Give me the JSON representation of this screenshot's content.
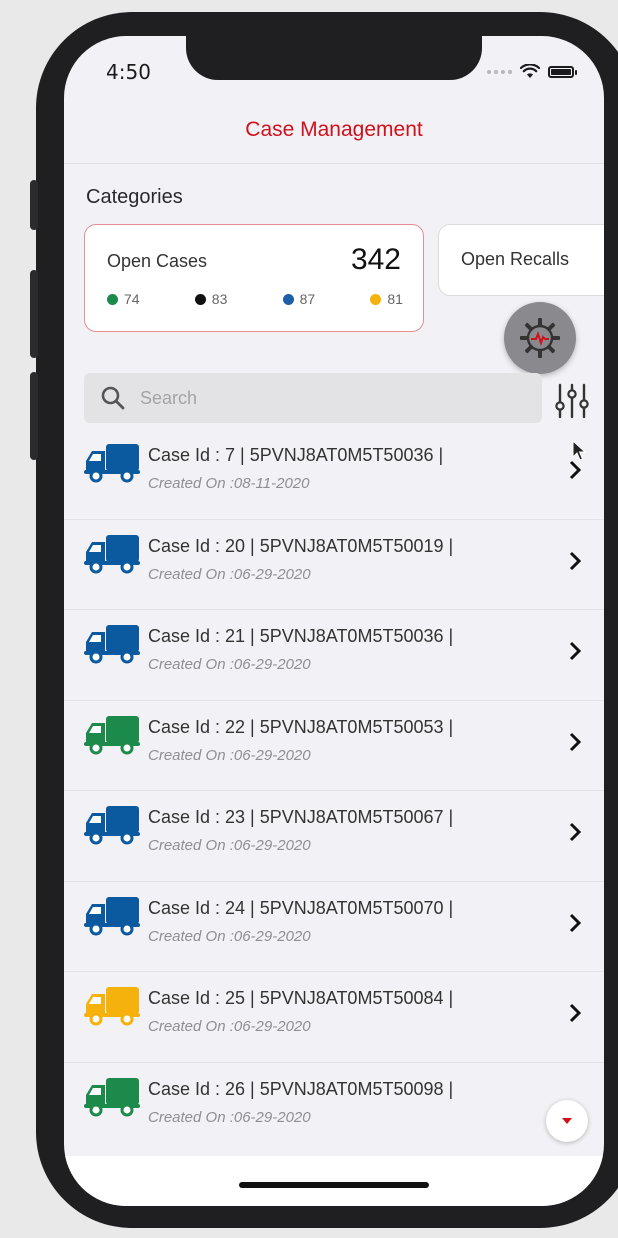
{
  "status": {
    "time": "4:50"
  },
  "nav": {
    "title": "Case Management"
  },
  "categories": {
    "title": "Categories",
    "open_cases": {
      "label": "Open Cases",
      "count": "342",
      "dots": [
        {
          "value": "74",
          "color": "#1b8a4a"
        },
        {
          "value": "83",
          "color": "#111111"
        },
        {
          "value": "87",
          "color": "#1f5fa8"
        },
        {
          "value": "81",
          "color": "#f6b20c"
        }
      ]
    },
    "open_recalls": {
      "label": "Open Recalls"
    }
  },
  "search": {
    "placeholder": "Search"
  },
  "cases": [
    {
      "title": "Case Id : 7 | 5PVNJ8AT0M5T50036 |",
      "date": "Created On :08-11-2020",
      "truck_color": "#0b5aa0"
    },
    {
      "title": "Case Id : 20 | 5PVNJ8AT0M5T50019 |",
      "date": "Created On :06-29-2020",
      "truck_color": "#0b5aa0"
    },
    {
      "title": "Case Id : 21 | 5PVNJ8AT0M5T50036 |",
      "date": "Created On :06-29-2020",
      "truck_color": "#0b5aa0"
    },
    {
      "title": "Case Id : 22 | 5PVNJ8AT0M5T50053 |",
      "date": "Created On :06-29-2020",
      "truck_color": "#1b8a4a"
    },
    {
      "title": "Case Id : 23 | 5PVNJ8AT0M5T50067 |",
      "date": "Created On :06-29-2020",
      "truck_color": "#0b5aa0"
    },
    {
      "title": "Case Id : 24 | 5PVNJ8AT0M5T50070 |",
      "date": "Created On :06-29-2020",
      "truck_color": "#0b5aa0"
    },
    {
      "title": "Case Id : 25 | 5PVNJ8AT0M5T50084 |",
      "date": "Created On :06-29-2020",
      "truck_color": "#f6b20c"
    },
    {
      "title": "Case Id : 26 | 5PVNJ8AT0M5T50098 |",
      "date": "Created On :06-29-2020",
      "truck_color": "#1b8a4a"
    }
  ],
  "icons": {
    "search": "search-icon",
    "filter": "sliders-icon",
    "gear": "gear-icon",
    "chevron": "chevron-right-icon",
    "truck": "truck-icon",
    "scroll": "chevron-down-icon"
  },
  "colors": {
    "accent": "#d0111b"
  }
}
